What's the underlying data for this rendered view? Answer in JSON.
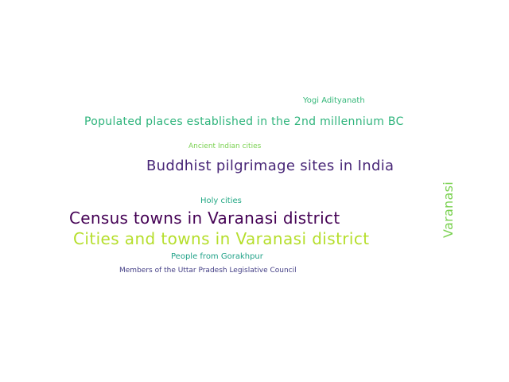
{
  "wordcloud": {
    "words": [
      {
        "key": "yogi",
        "text": "Yogi Adityanath",
        "color": "#35b779"
      },
      {
        "key": "populated",
        "text": "Populated places established in the 2nd millennium BC",
        "color": "#2fb47c"
      },
      {
        "key": "ancient",
        "text": "Ancient Indian cities",
        "color": "#7ad151"
      },
      {
        "key": "buddhist",
        "text": "Buddhist pilgrimage sites in India",
        "color": "#482677"
      },
      {
        "key": "holy",
        "text": "Holy cities",
        "color": "#22a884"
      },
      {
        "key": "census",
        "text": "Census towns in Varanasi district",
        "color": "#440154"
      },
      {
        "key": "cities",
        "text": "Cities and towns in Varanasi district",
        "color": "#b5de2b"
      },
      {
        "key": "people",
        "text": "People from Gorakhpur",
        "color": "#1fa187"
      },
      {
        "key": "members",
        "text": "Members of the Uttar Pradesh Legislative Council",
        "color": "#433e85"
      },
      {
        "key": "varanasi",
        "text": "Varanasi",
        "color": "#7ad151"
      }
    ]
  }
}
